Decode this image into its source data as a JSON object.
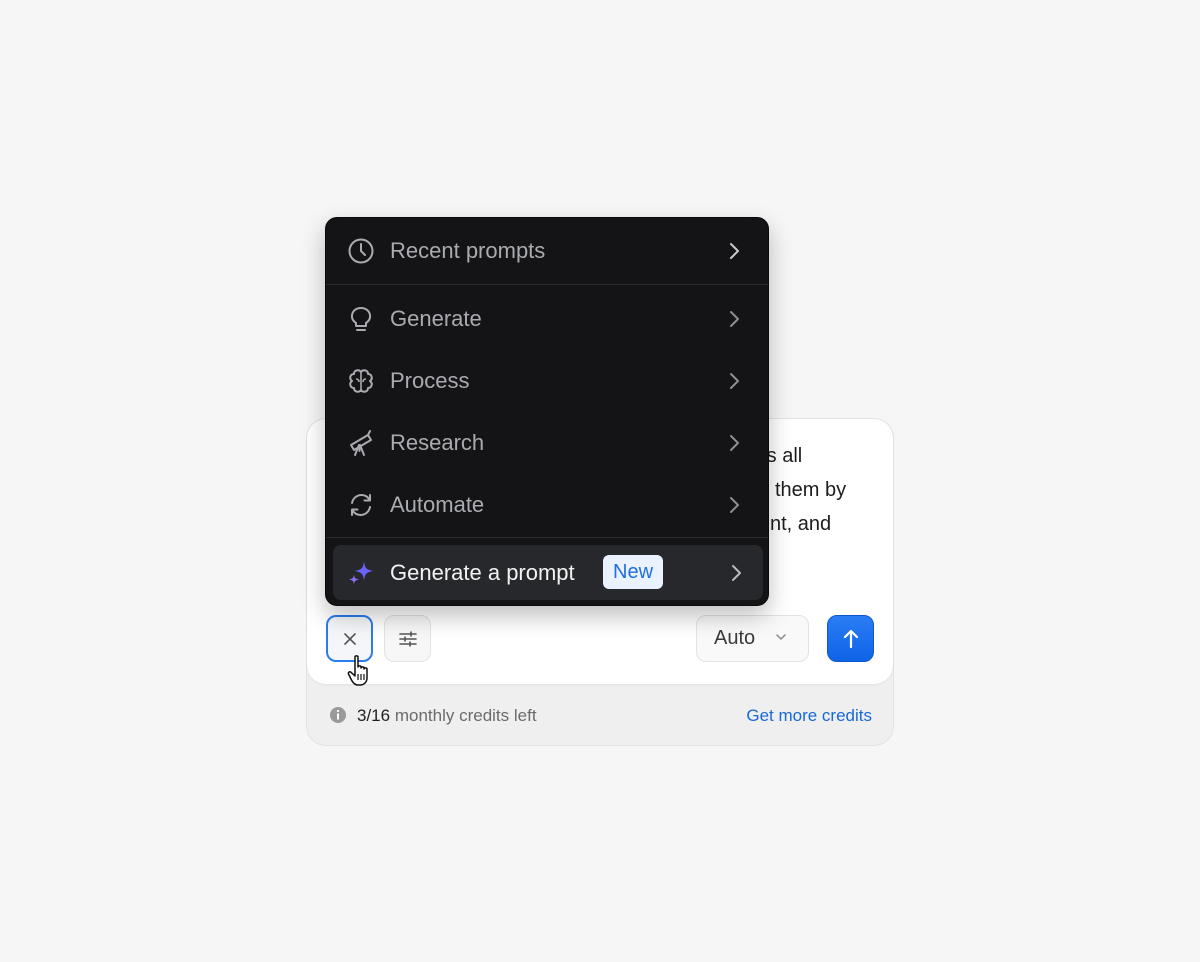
{
  "prompt_text": {
    "line1": "rs all",
    "line2": "them by",
    "line3": "nt, and"
  },
  "menu": {
    "items": [
      {
        "label": "Recent prompts",
        "icon": "clock-icon"
      },
      {
        "label": "Generate",
        "icon": "lightbulb-icon"
      },
      {
        "label": "Process",
        "icon": "brain-icon"
      },
      {
        "label": "Research",
        "icon": "telescope-icon"
      },
      {
        "label": "Automate",
        "icon": "refresh-icon"
      },
      {
        "label": "Generate a prompt",
        "icon": "sparkle-icon",
        "badge": "New"
      }
    ]
  },
  "toolbar": {
    "close_icon": "close-icon",
    "settings_icon": "sliders-icon",
    "mode_value": "Auto",
    "send_icon": "arrow-up-icon"
  },
  "footer": {
    "credits_count": "3/16",
    "credits_label": "monthly credits left",
    "get_more": "Get more credits"
  },
  "colors": {
    "accent": "#1769d6",
    "send_button": "#1366ea",
    "menu_bg": "#141416",
    "badge_bg": "#e9f2fe",
    "sparkle": "#6a63f5"
  }
}
